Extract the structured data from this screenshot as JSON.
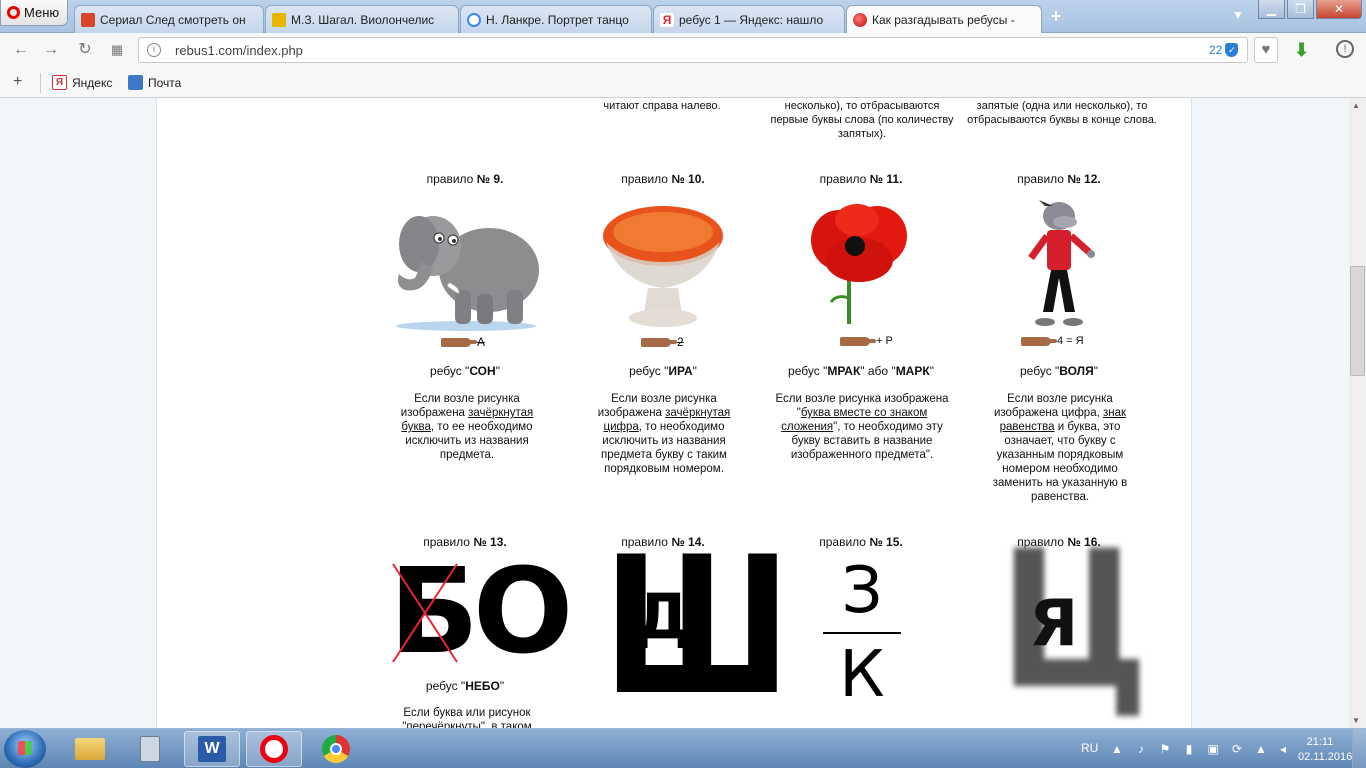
{
  "browser": {
    "menu_label": "Меню",
    "tabs": [
      {
        "title": "Сериал След смотреть он",
        "favicon_color": "#d8452b"
      },
      {
        "title": "М.З. Шагал. Виолончелис",
        "favicon_color": "#e8b400"
      },
      {
        "title": "Н. Ланкре. Портрет танцо",
        "favicon_color": "#4285f4"
      },
      {
        "title": "ребус 1 — Яндекс: нашло",
        "favicon_color": "#e23"
      },
      {
        "title": "Как разгадывать ребусы -",
        "favicon_color": "#cc2a2a"
      }
    ],
    "url": "rebus1.com/index.php",
    "adblock_count": "22",
    "bookmarks": [
      {
        "label": "Яндекс",
        "icon": "yandex-icon"
      },
      {
        "label": "Почта",
        "icon": "mail-icon"
      }
    ]
  },
  "page": {
    "top_texts": [
      "читают справа налево.",
      "несколько), то отбрасываются первые буквы слова (по количеству запятых).",
      "запятые (одна или несколько), то отбрасываются буквы в конце слова."
    ],
    "rule_word": "правило",
    "rules": [
      {
        "num": "№ 9.",
        "hint": "А",
        "answer_prefix": "ребус \"",
        "answer": "СОН",
        "answer_suffix": "\"",
        "desc_a": "Если возле рисунка изображена ",
        "desc_link": "зачёркнутая буква",
        "desc_b": ", то ее необходимо исключить из названия предмета."
      },
      {
        "num": "№ 10.",
        "hint": "2",
        "answer_prefix": "ребус \"",
        "answer": "ИРА",
        "answer_suffix": "\"",
        "desc_a": "Если возле рисунка изображена ",
        "desc_link": "зачёркнутая цифра",
        "desc_b": ", то необходимо исключить из названия предмета букву с таким порядковым номером."
      },
      {
        "num": "№ 11.",
        "hint": "+ Р",
        "answer_prefix": "ребус \"",
        "answer": "МРАК",
        "answer_mid": "\" або \"",
        "answer2": "МАРК",
        "answer_suffix": "\"",
        "desc_a": "Если возле рисунка изображена \"",
        "desc_link": "буква вместе со знаком сложения",
        "desc_b": "\", то необходимо эту букву вставить в название изображенного предмета\"."
      },
      {
        "num": "№ 12.",
        "hint": "4 = Я",
        "answer_prefix": "ребус \"",
        "answer": "ВОЛЯ",
        "answer_suffix": "\"",
        "desc_a": "Если возле рисунка изображена цифра, ",
        "desc_link": "знак равенства",
        "desc_b": " и буква, это означает, что букву с указанным порядковым номером необходимо заменить на указанную в равенства."
      },
      {
        "num": "№ 13.",
        "answer_prefix": "ребус \"",
        "answer": "НЕБО",
        "answer_suffix": "\"",
        "desc_a": "Если буква или рисунок \"перечёркнуты\", в таком",
        "pic_letters": "БО"
      },
      {
        "num": "№ 14.",
        "pic_outer": "Ш",
        "pic_inner": "Д"
      },
      {
        "num": "№ 15.",
        "pic_top": "З",
        "pic_bottom": "К"
      },
      {
        "num": "№ 16.",
        "pic_outer": "Ц",
        "pic_inner": "Я"
      }
    ]
  },
  "taskbar": {
    "apps": [
      "file-explorer",
      "calculator",
      "word",
      "opera",
      "chrome"
    ],
    "lang": "RU",
    "time": "21:11",
    "date": "02.11.2016"
  }
}
